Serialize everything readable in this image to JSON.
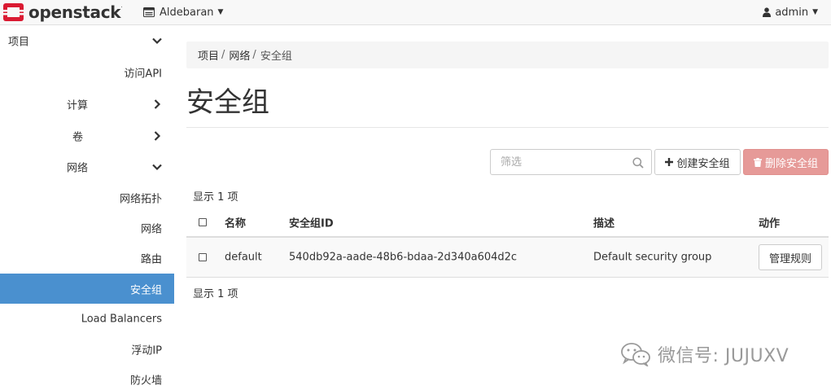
{
  "topbar": {
    "brand": "openstack",
    "brand_mark": ".",
    "project_name": "Aldebaran",
    "user_name": "admin",
    "brand_color": "#da1a32"
  },
  "sidebar": {
    "items": [
      {
        "label": "项目",
        "chevron": "down"
      },
      {
        "label": "访问API"
      },
      {
        "label": "计算",
        "chevron": "right"
      },
      {
        "label": "卷",
        "chevron": "right"
      },
      {
        "label": "网络",
        "chevron": "down"
      },
      {
        "label": "网络拓扑"
      },
      {
        "label": "网络"
      },
      {
        "label": "路由"
      },
      {
        "label": "安全组",
        "active": true
      },
      {
        "label": "Load Balancers"
      },
      {
        "label": "浮动IP"
      },
      {
        "label": "防火墙"
      }
    ],
    "active_color": "#4a90cf"
  },
  "breadcrumb": {
    "items": [
      "项目",
      "网络",
      "安全组"
    ]
  },
  "page": {
    "title": "安全组"
  },
  "toolbar": {
    "filter_placeholder": "筛选",
    "create_label": "创建安全组",
    "delete_label": "删除安全组"
  },
  "table": {
    "count_label": "显示 1 项",
    "headers": {
      "name": "名称",
      "id": "安全组ID",
      "description": "描述",
      "actions": "动作"
    },
    "rows": [
      {
        "name": "default",
        "id": "540db92a-aade-48b6-bdaa-2d340a604d2c",
        "description": "Default security group",
        "action_label": "管理规则"
      }
    ]
  },
  "watermark": {
    "text": "微信号: JUJUXV"
  }
}
